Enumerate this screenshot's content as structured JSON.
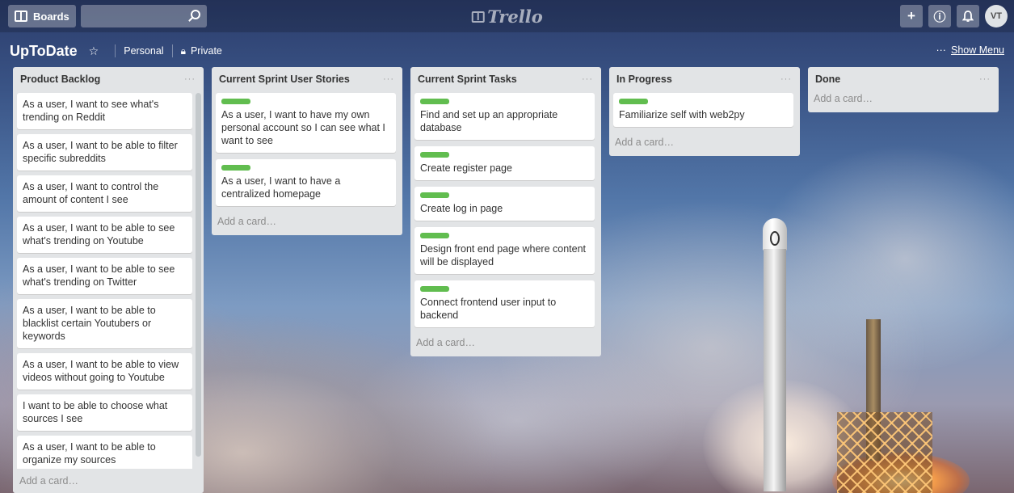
{
  "header": {
    "boards_label": "Boards",
    "search_value": "",
    "brand": "Trello",
    "create_icon": "+",
    "info_icon": "ⓘ",
    "notification_icon": "bell",
    "avatar_initials": "VT"
  },
  "board": {
    "title": "UpToDate",
    "team": "Personal",
    "visibility": "Private",
    "show_menu_dots": "···",
    "show_menu_label": "Show Menu"
  },
  "lists": [
    {
      "title": "Product Backlog",
      "menu": "···",
      "cards": [
        "As a user, I want to see what's trending on Reddit",
        "As a user, I want to be able to filter specific subreddits",
        "As a user, I want to control the amount of content I see",
        "As a user, I want to be able to see what's trending on Youtube",
        "As a user, I want to be able to see what's trending on Twitter",
        "As a user, I want to be able to blacklist certain Youtubers or keywords",
        "As a user, I want to be able to view videos without going to Youtube",
        "I want to be able to choose what sources I see",
        "As a user, I want to be able to organize my sources"
      ],
      "add_card": "Add a card…"
    },
    {
      "title": "Current Sprint User Stories",
      "menu": "···",
      "cards": [
        "As a user, I want to have my own personal account so I can see what I want to see",
        "As a user, I want to have a centralized homepage"
      ],
      "add_card": "Add a card…"
    },
    {
      "title": "Current Sprint Tasks",
      "menu": "···",
      "cards": [
        "Find and set up an appropriate database",
        "Create register page",
        "Create log in page",
        "Design front end page where content will be displayed",
        "Connect frontend user input to backend"
      ],
      "add_card": "Add a card…"
    },
    {
      "title": "In Progress",
      "menu": "···",
      "cards": [
        "Familiarize self with web2py"
      ],
      "add_card": "Add a card…"
    },
    {
      "title": "Done",
      "menu": "···",
      "cards": [],
      "add_card": "Add a card…"
    }
  ],
  "colors": {
    "label_green": "#61bd4f",
    "list_bg": "#e2e4e6"
  }
}
